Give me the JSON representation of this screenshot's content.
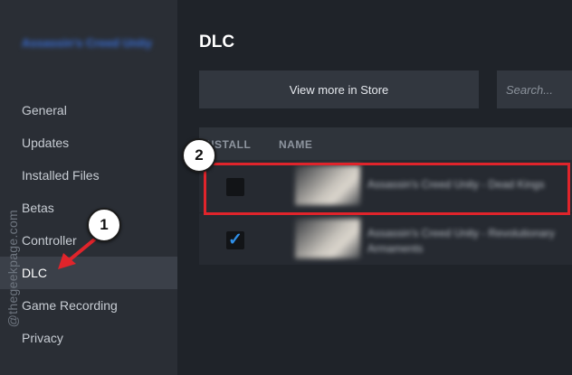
{
  "sidebar": {
    "game_title": "Assassin's Creed Unity",
    "items": [
      {
        "label": "General"
      },
      {
        "label": "Updates"
      },
      {
        "label": "Installed Files"
      },
      {
        "label": "Betas"
      },
      {
        "label": "Controller"
      },
      {
        "label": "DLC"
      },
      {
        "label": "Game Recording"
      },
      {
        "label": "Privacy"
      }
    ],
    "active_item": "DLC"
  },
  "watermark": "@thegeekpage.com",
  "main": {
    "title": "DLC",
    "store_button": "View more in Store",
    "search_placeholder": "Search...",
    "columns": {
      "install": "INSTALL",
      "name": "NAME"
    },
    "rows": [
      {
        "installed": false,
        "name": "Assassin's Creed Unity - Dead Kings"
      },
      {
        "installed": true,
        "name": "Assassin's Creed Unity - Revolutionary Armaments"
      }
    ]
  },
  "annotations": {
    "step1": "1",
    "step2": "2",
    "accent_color": "#e0242b"
  },
  "icons": {
    "checkmark": "✓"
  }
}
